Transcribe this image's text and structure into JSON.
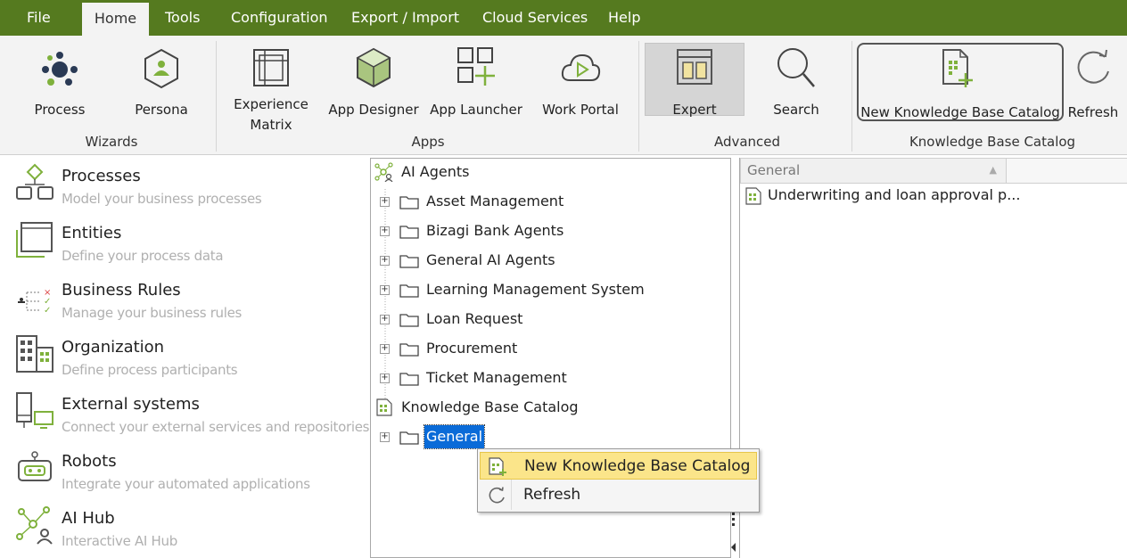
{
  "menu": {
    "tabs": [
      "File",
      "Home",
      "Tools",
      "Configuration",
      "Export / Import",
      "Cloud Services",
      "Help"
    ],
    "active": "Home"
  },
  "ribbon": {
    "groups": {
      "wizards": "Wizards",
      "apps": "Apps",
      "advanced": "Advanced",
      "kb": "Knowledge Base Catalog"
    },
    "buttons": {
      "process": "Process",
      "persona": "Persona",
      "experience_matrix_1": "Experience",
      "experience_matrix_2": "Matrix",
      "app_designer": "App Designer",
      "app_launcher": "App Launcher",
      "work_portal": "Work Portal",
      "expert": "Expert",
      "search": "Search",
      "new_kb_catalog": "New Knowledge Base Catalog",
      "refresh": "Refresh"
    },
    "accent": "#557a1f"
  },
  "nav": {
    "items": [
      {
        "title": "Processes",
        "sub": "Model your business processes",
        "icon": "processes-icon"
      },
      {
        "title": "Entities",
        "sub": "Define your process data",
        "icon": "entities-icon"
      },
      {
        "title": "Business Rules",
        "sub": "Manage your business rules",
        "icon": "business-rules-icon"
      },
      {
        "title": "Organization",
        "sub": "Define process participants",
        "icon": "organization-icon"
      },
      {
        "title": "External systems",
        "sub": "Connect your external services and repositories",
        "icon": "external-systems-icon"
      },
      {
        "title": "Robots",
        "sub": "Integrate your automated applications",
        "icon": "robot-icon"
      },
      {
        "title": "AI Hub",
        "sub": "Interactive AI Hub",
        "icon": "ai-hub-icon"
      }
    ]
  },
  "tree": {
    "root": "AI Agents",
    "folders": [
      "Asset Management",
      "Bizagi Bank Agents",
      "General AI Agents",
      "Learning Management System",
      "Loan Request",
      "Procurement",
      "Ticket Management"
    ],
    "kb_root": "Knowledge Base Catalog",
    "kb_folder": "General"
  },
  "right": {
    "column": "General",
    "rows": [
      "Underwriting and loan approval p..."
    ]
  },
  "context_menu": {
    "items": [
      "New Knowledge Base Catalog",
      "Refresh"
    ]
  }
}
